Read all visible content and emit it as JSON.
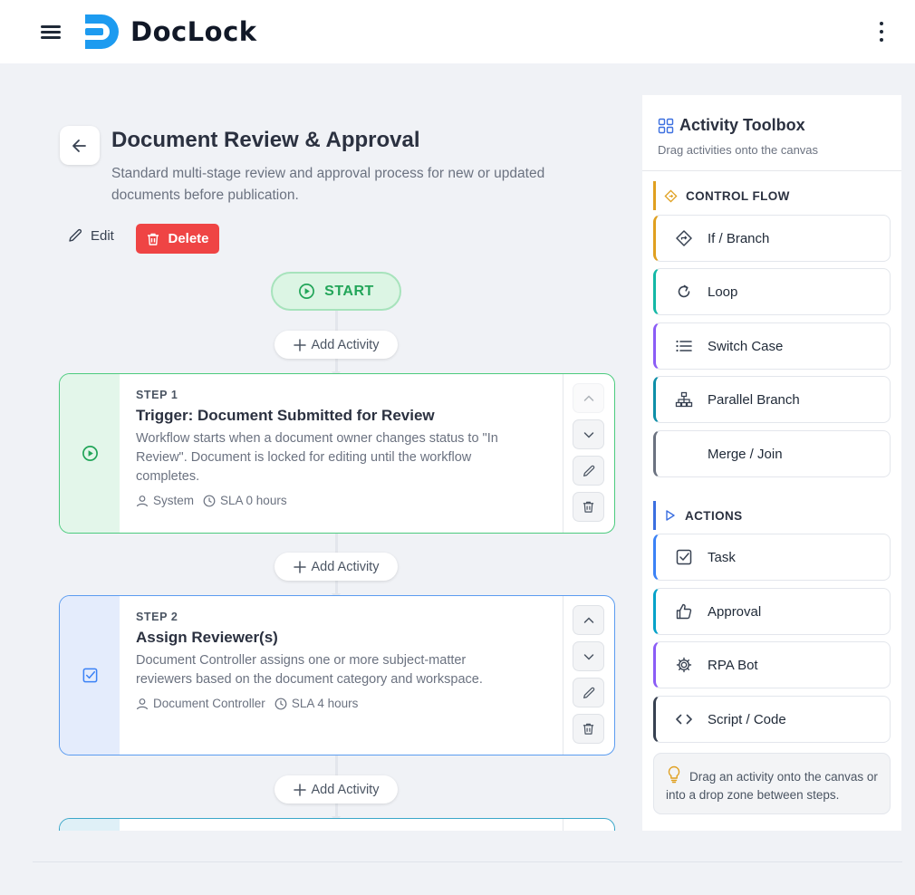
{
  "app": {
    "logo_text": "DocLock",
    "brand_color": "#1d9bf0"
  },
  "page": {
    "title": "Document Review & Approval",
    "description": "Standard multi-stage review and approval process for new or updated documents before publication.",
    "edit_label": "Edit",
    "delete_label": "Delete"
  },
  "canvas": {
    "start_label": "START",
    "add_activity_label": "Add Activity",
    "steps": [
      {
        "label": "STEP 1",
        "title": "Trigger: Document Submitted for Review",
        "description": "Workflow starts when a document owner changes status to \"In Review\". Document is locked for editing until the workflow completes.",
        "owner": "System",
        "sla": "SLA 0 hours",
        "icon": "play-circle-icon",
        "color": "#22a559"
      },
      {
        "label": "STEP 2",
        "title": "Assign Reviewer(s)",
        "description": "Document Controller assigns one or more subject-matter reviewers based on the document category and workspace.",
        "owner": "Document Controller",
        "sla": "SLA 4 hours",
        "icon": "checkbox-icon",
        "color": "#3b82f6"
      }
    ]
  },
  "toolbox": {
    "title": "Activity Toolbox",
    "subtitle": "Drag activities onto the canvas",
    "sections": [
      {
        "title": "CONTROL FLOW",
        "color": "#e0a020",
        "items": [
          {
            "label": "If / Branch",
            "icon": "branch-icon",
            "color": "#e0a020"
          },
          {
            "label": "Loop",
            "icon": "loop-icon",
            "color": "#14b8a6"
          },
          {
            "label": "Switch Case",
            "icon": "list-icon",
            "color": "#8b5cf6"
          },
          {
            "label": "Parallel Branch",
            "icon": "hierarchy-icon",
            "color": "#0e8fa8"
          },
          {
            "label": "Merge / Join",
            "icon": "merge-icon",
            "color": "#6b7280"
          }
        ]
      },
      {
        "title": "ACTIONS",
        "color": "#3b6fe0",
        "items": [
          {
            "label": "Task",
            "icon": "task-check-icon",
            "color": "#3b82f6"
          },
          {
            "label": "Approval",
            "icon": "thumbs-up-icon",
            "color": "#06a2c9"
          },
          {
            "label": "RPA Bot",
            "icon": "gear-icon",
            "color": "#8b5cf6"
          },
          {
            "label": "Script / Code",
            "icon": "code-icon",
            "color": "#374151"
          }
        ]
      }
    ],
    "tip": "Drag an activity onto the canvas or into a drop zone between steps."
  }
}
